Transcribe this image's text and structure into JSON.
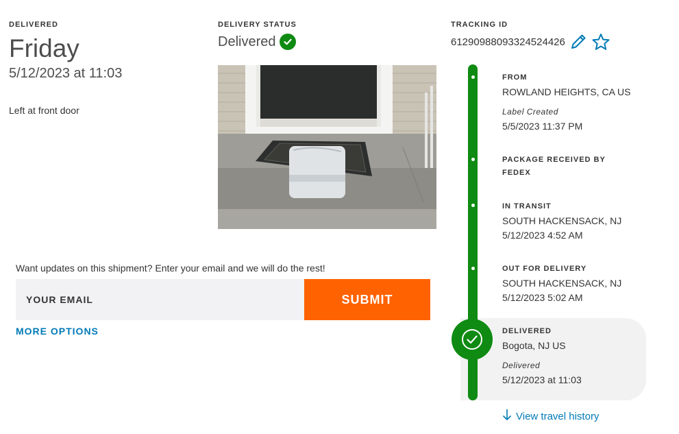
{
  "delivered": {
    "label": "DELIVERED",
    "day": "Friday",
    "datetime": "5/12/2023 at 11:03",
    "note": "Left at front door"
  },
  "status": {
    "label": "DELIVERY STATUS",
    "value": "Delivered",
    "icon": "check-circle-icon",
    "color": "#0f8a12"
  },
  "tracking": {
    "label": "TRACKING ID",
    "id": "612909880933245244 26",
    "id_full": "61290988093324524426",
    "edit_icon": "pencil-icon",
    "watch_icon": "star-icon"
  },
  "email_signup": {
    "prompt": "Want updates on this shipment? Enter your email and we will do the rest!",
    "placeholder": "YOUR EMAIL",
    "submit_label": "SUBMIT",
    "more_options": "MORE OPTIONS"
  },
  "timeline": {
    "events": [
      {
        "title": "FROM",
        "location": "ROWLAND HEIGHTS, CA US",
        "note": "Label Created",
        "datetime": "5/5/2023 11:37 PM"
      },
      {
        "title": "PACKAGE RECEIVED BY FEDEX"
      },
      {
        "title": "IN TRANSIT",
        "location": "SOUTH HACKENSACK, NJ",
        "datetime": "5/12/2023 4:52 AM"
      },
      {
        "title": "OUT FOR DELIVERY",
        "location": "SOUTH HACKENSACK, NJ",
        "datetime": "5/12/2023 5:02 AM"
      },
      {
        "title": "DELIVERED",
        "location": "Bogota, NJ US",
        "note": "Delivered",
        "datetime": "5/12/2023 at 11:03"
      }
    ],
    "travel_history": "View travel history"
  },
  "colors": {
    "accent_orange": "#ff6200",
    "link_blue": "#007ab7",
    "success_green": "#0f8a12"
  }
}
